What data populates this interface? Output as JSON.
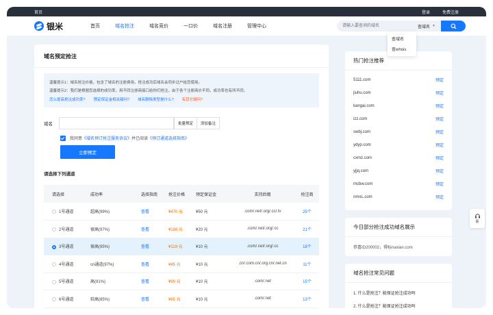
{
  "topbar": {
    "home": "首页",
    "login": "登录",
    "register": "免费注册"
  },
  "logo": {
    "text": "银米"
  },
  "nav": {
    "items": [
      {
        "label": "首页",
        "active": false
      },
      {
        "label": "域名抢注",
        "active": true
      },
      {
        "label": "域名竞价",
        "active": false
      },
      {
        "label": "一口价",
        "active": false
      },
      {
        "label": "域名注册",
        "active": false
      },
      {
        "label": "管理中心",
        "active": false
      }
    ]
  },
  "search": {
    "placeholder": "请输入要查询的域名",
    "select_value": "查域名",
    "dropdown_options": [
      "查域名",
      "查whois"
    ]
  },
  "main": {
    "title": "域名预定抢注",
    "tips": [
      "温馨提示1：域名抢注价格，包含了域名的注册费用，抢注成功后域名会同步过户给您使用。",
      "温馨提示2：我们是根据您选择的成功率，用不同注册商接口给你们抢注，由于各个注册商价不同，成功率也有所不同。"
    ],
    "tip_links": [
      {
        "label": "怎么提高抢注成功率?",
        "color": "blue"
      },
      {
        "label": "预定保证金相关疑问?",
        "color": "blue"
      },
      {
        "label": "域名删除类型是什么?",
        "color": "blue"
      },
      {
        "label": "有其它疑问?",
        "color": "red"
      }
    ],
    "domain_label": "域名",
    "batch_button": "批量预定",
    "note_button": "添加备注",
    "agree_prefix": "我同意",
    "agree_link1": "《域名预订抢注服务协议》",
    "agree_middle": "并已阅读",
    "agree_link2": "《预订通道选择指南》",
    "submit_button": "立即预定",
    "channel_title": "请选择下列通道",
    "table": {
      "headers": [
        "请选择",
        "成功率",
        "选择指南",
        "抢注价格",
        "预定保证金",
        "支持后缀",
        "抢注商"
      ],
      "rows": [
        {
          "channel": "1号通道",
          "rate": "超高(99%)",
          "guide": "查看",
          "price": "¥470 元",
          "deposit": "¥50 元",
          "suffix": ".com/.net/.org/.cc/.tv",
          "count": "25个",
          "selected": false
        },
        {
          "channel": "2号通道",
          "rate": "很高(97%)",
          "guide": "查看",
          "price": "¥188 元",
          "deposit": "¥20 元",
          "suffix": ".com/.net/.org/.cc",
          "count": "21个",
          "selected": false
        },
        {
          "channel": "3号通道",
          "rate": "很高(95%)",
          "guide": "查看",
          "price": "¥119 元",
          "deposit": "¥10 元",
          "suffix": ".com/.net/.org/.cc",
          "count": "18个",
          "selected": true
        },
        {
          "channel": "4号通道",
          "rate": "cn通道(97%)",
          "guide": "查看",
          "price": "¥45 元",
          "deposit": "¥10 元",
          "suffix": ".cn/.com.cn/.org.cn/.net.cn",
          "count": "11个",
          "selected": false
        },
        {
          "channel": "5号通道",
          "rate": "高(91%)",
          "guide": "查看",
          "price": "¥99 元",
          "deposit": "¥10 元",
          "suffix": ".com/.net",
          "count": "15个",
          "selected": false
        },
        {
          "channel": "6号通道",
          "rate": "较高(85%)",
          "guide": "查看",
          "price": "¥85 元",
          "deposit": "¥10 元",
          "suffix": ".com/.net",
          "count": "13个",
          "selected": false
        }
      ]
    }
  },
  "hot": {
    "title": "热门抢注推荐",
    "reserve_label": "预定",
    "domains": [
      "5111.com",
      "jiuhu.com",
      "kangai.com",
      "izz.com",
      "swbj.com",
      "ydyp.com",
      "cxmz.com",
      "yjjq.com",
      "mcbw.com",
      "nmxL.com"
    ]
  },
  "today": {
    "title": "今日部分抢注成功域名展示",
    "text": "恭喜ID200002，得标naxian.com"
  },
  "faq": {
    "title": "域名抢注常见问题",
    "items": [
      "1. 什么是抢注？能保证抢注成功吗",
      "2. 什么是抢注？能保证抢注成功吗"
    ]
  },
  "help": {
    "label": "联"
  },
  "colors": {
    "accent": "#1677ff",
    "price": "#ff6a00",
    "topbar": "#2a2f3c",
    "selected_row": "#e3f2fc"
  }
}
